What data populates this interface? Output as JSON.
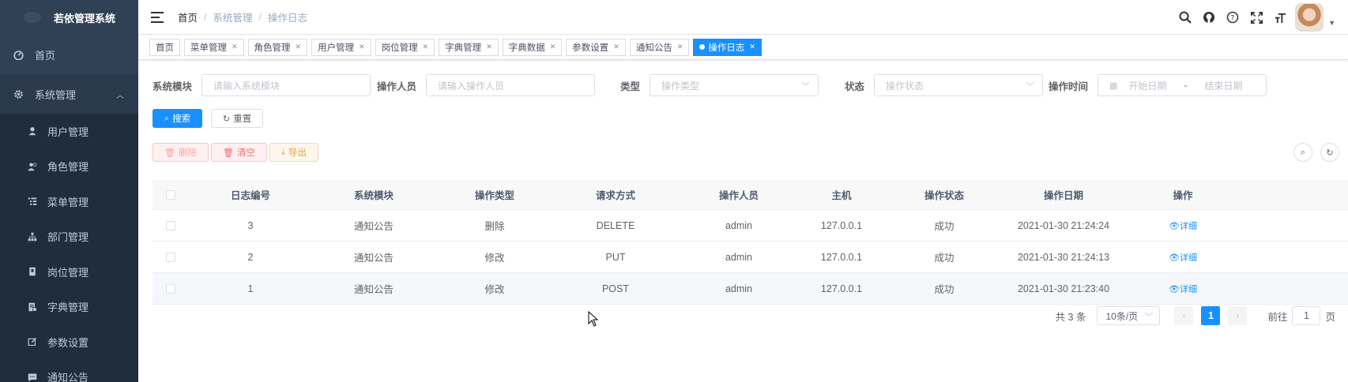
{
  "sidebar": {
    "title": "若依管理系统",
    "home": {
      "label": "首页",
      "icon": "dashboard-icon"
    },
    "group": {
      "label": "系统管理",
      "icon": "gear-icon",
      "expanded": true
    },
    "items": [
      {
        "label": "用户管理",
        "icon": "user-icon"
      },
      {
        "label": "角色管理",
        "icon": "peoples-icon"
      },
      {
        "label": "菜单管理",
        "icon": "tree-table-icon"
      },
      {
        "label": "部门管理",
        "icon": "tree-icon"
      },
      {
        "label": "岗位管理",
        "icon": "post-icon"
      },
      {
        "label": "字典管理",
        "icon": "dict-icon"
      },
      {
        "label": "参数设置",
        "icon": "edit-icon"
      },
      {
        "label": "通知公告",
        "icon": "message-icon"
      }
    ]
  },
  "navbar": {
    "breadcrumb": [
      "首页",
      "系统管理",
      "操作日志"
    ]
  },
  "tags": [
    {
      "label": "首页",
      "closable": false
    },
    {
      "label": "菜单管理",
      "closable": true
    },
    {
      "label": "角色管理",
      "closable": true
    },
    {
      "label": "用户管理",
      "closable": true
    },
    {
      "label": "岗位管理",
      "closable": true
    },
    {
      "label": "字典管理",
      "closable": true
    },
    {
      "label": "字典数据",
      "closable": true
    },
    {
      "label": "参数设置",
      "closable": true
    },
    {
      "label": "通知公告",
      "closable": true
    },
    {
      "label": "操作日志",
      "closable": true,
      "active": true
    }
  ],
  "search": {
    "module_label": "系统模块",
    "module_placeholder": "请输入系统模块",
    "operator_label": "操作人员",
    "operator_placeholder": "请输入操作人员",
    "type_label": "类型",
    "type_placeholder": "操作类型",
    "status_label": "状态",
    "status_placeholder": "操作状态",
    "time_label": "操作时间",
    "start_placeholder": "开始日期",
    "date_sep": "-",
    "end_placeholder": "结束日期",
    "search_btn": "搜索",
    "reset_btn": "重置"
  },
  "toolbar": {
    "delete_btn": "删除",
    "clean_btn": "清空",
    "export_btn": "导出"
  },
  "table": {
    "columns": [
      "日志编号",
      "系统模块",
      "操作类型",
      "请求方式",
      "操作人员",
      "主机",
      "操作状态",
      "操作日期",
      "操作"
    ],
    "rows": [
      {
        "id": "3",
        "module": "通知公告",
        "type": "删除",
        "method": "DELETE",
        "operator": "admin",
        "host": "127.0.0.1",
        "status": "成功",
        "date": "2021-01-30 21:24:24",
        "action": "详细"
      },
      {
        "id": "2",
        "module": "通知公告",
        "type": "修改",
        "method": "PUT",
        "operator": "admin",
        "host": "127.0.0.1",
        "status": "成功",
        "date": "2021-01-30 21:24:13",
        "action": "详细"
      },
      {
        "id": "1",
        "module": "通知公告",
        "type": "修改",
        "method": "POST",
        "operator": "admin",
        "host": "127.0.0.1",
        "status": "成功",
        "date": "2021-01-30 21:23:40",
        "action": "详细"
      }
    ]
  },
  "pagination": {
    "total": "共 3 条",
    "page_size": "10条/页",
    "current_page": "1",
    "goto_label": "前往",
    "goto_value": "1",
    "page_suffix": "页"
  }
}
